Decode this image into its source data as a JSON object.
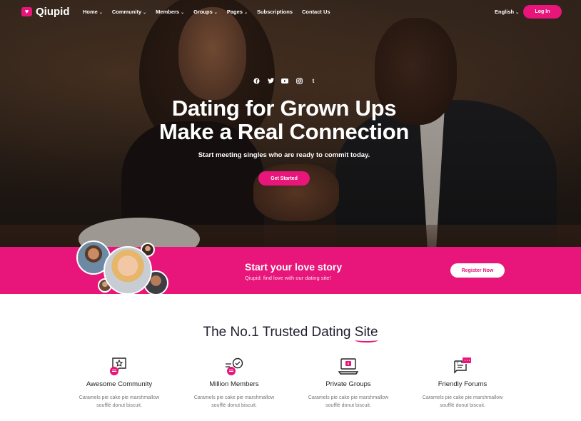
{
  "brand": {
    "name": "Qiupid",
    "accent": "#e8157a"
  },
  "nav": {
    "items": [
      {
        "label": "Home",
        "has_dropdown": true
      },
      {
        "label": "Community",
        "has_dropdown": true
      },
      {
        "label": "Members",
        "has_dropdown": true
      },
      {
        "label": "Groups",
        "has_dropdown": true
      },
      {
        "label": "Pages",
        "has_dropdown": true
      },
      {
        "label": "Subscriptions",
        "has_dropdown": false
      },
      {
        "label": "Contact Us",
        "has_dropdown": false
      }
    ],
    "language": "English",
    "login_label": "Log In"
  },
  "hero": {
    "socials": [
      "facebook-icon",
      "twitter-icon",
      "youtube-icon",
      "instagram-icon",
      "tumblr-icon"
    ],
    "title_line1": "Dating for Grown Ups",
    "title_line2": "Make a Real Connection",
    "subtitle": "Start meeting singles who are ready to commit today.",
    "cta_label": "Get Started"
  },
  "band": {
    "title": "Start your love story",
    "subtitle": "Qiupid: find love with our dating site!",
    "cta_label": "Register Now"
  },
  "features": {
    "title_main": "The No.1 Trusted Dating ",
    "title_highlight": "Site",
    "items": [
      {
        "title": "Awesome Community",
        "desc_line1": "Caramels pie cake pie marshmallow",
        "desc_line2": "soufflé donut biscuit.",
        "icon": "community-icon"
      },
      {
        "title": "Million Members",
        "desc_line1": "Caramels pie cake pie marshmallow",
        "desc_line2": "soufflé donut biscuit.",
        "icon": "members-icon"
      },
      {
        "title": "Private Groups",
        "desc_line1": "Caramels pie cake pie marshmallow",
        "desc_line2": "soufflé donut biscuit.",
        "icon": "laptop-icon"
      },
      {
        "title": "Friendly Forums",
        "desc_line1": "Caramels pie cake pie marshmallow",
        "desc_line2": "soufflé donut biscuit.",
        "icon": "forum-icon"
      }
    ]
  }
}
